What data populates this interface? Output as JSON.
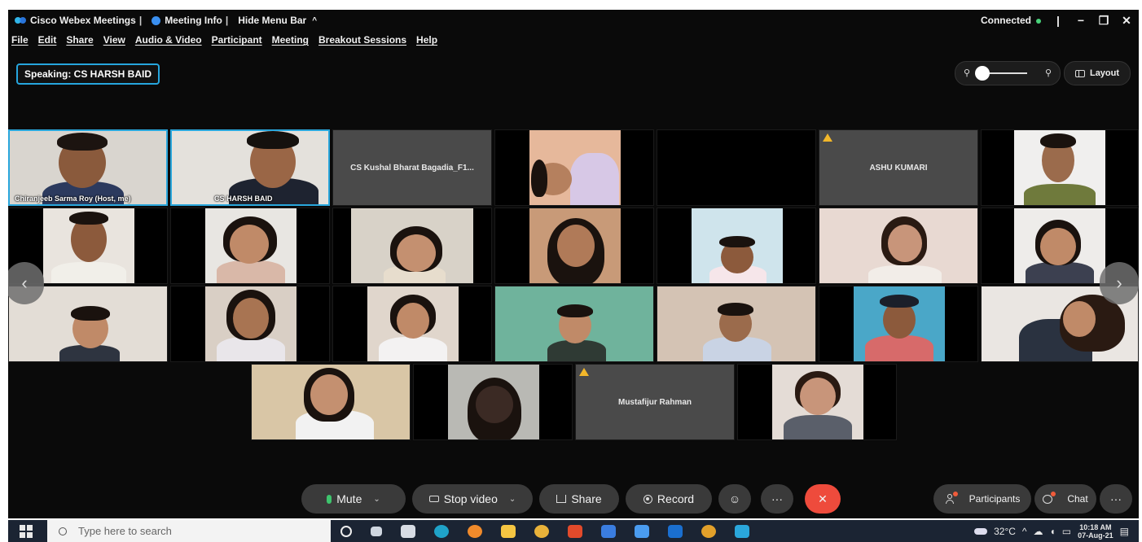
{
  "titlebar": {
    "app": "Cisco Webex Meetings",
    "meeting_info": "Meeting Info",
    "hide_menu": "Hide Menu Bar",
    "status": "Connected",
    "min": "−",
    "restore": "❐",
    "close": "✕"
  },
  "menu": [
    "File",
    "Edit",
    "Share",
    "View",
    "Audio & Video",
    "Participant",
    "Meeting",
    "Breakout Sessions",
    "Help"
  ],
  "speaking": "Speaking: CS HARSH BAID",
  "layout_label": "Layout",
  "tiles": {
    "t1_caption": "Chiranjeeb Sarma Roy (Host, me)",
    "t2_caption": "CS HARSH BAID",
    "t3_name": "CS Kushal Bharat Bagadia_F1...",
    "t6_name": "ASHU KUMARI",
    "t24_name": "Mustafijur Rahman"
  },
  "nav": {
    "prev": "‹",
    "next": "›"
  },
  "controls": {
    "mute": "Mute",
    "stop_video": "Stop video",
    "share": "Share",
    "record": "Record",
    "participants": "Participants",
    "chat": "Chat",
    "more": "···",
    "end": "✕",
    "chevron": "⌄"
  },
  "taskbar": {
    "search_placeholder": "Type here to search",
    "temperature": "32°C",
    "time": "10:18 AM",
    "date": "07-Aug-21"
  },
  "colors": {
    "accent": "#2aa7dc",
    "end_call": "#ee4b3c",
    "mic_on": "#3ec46d"
  }
}
